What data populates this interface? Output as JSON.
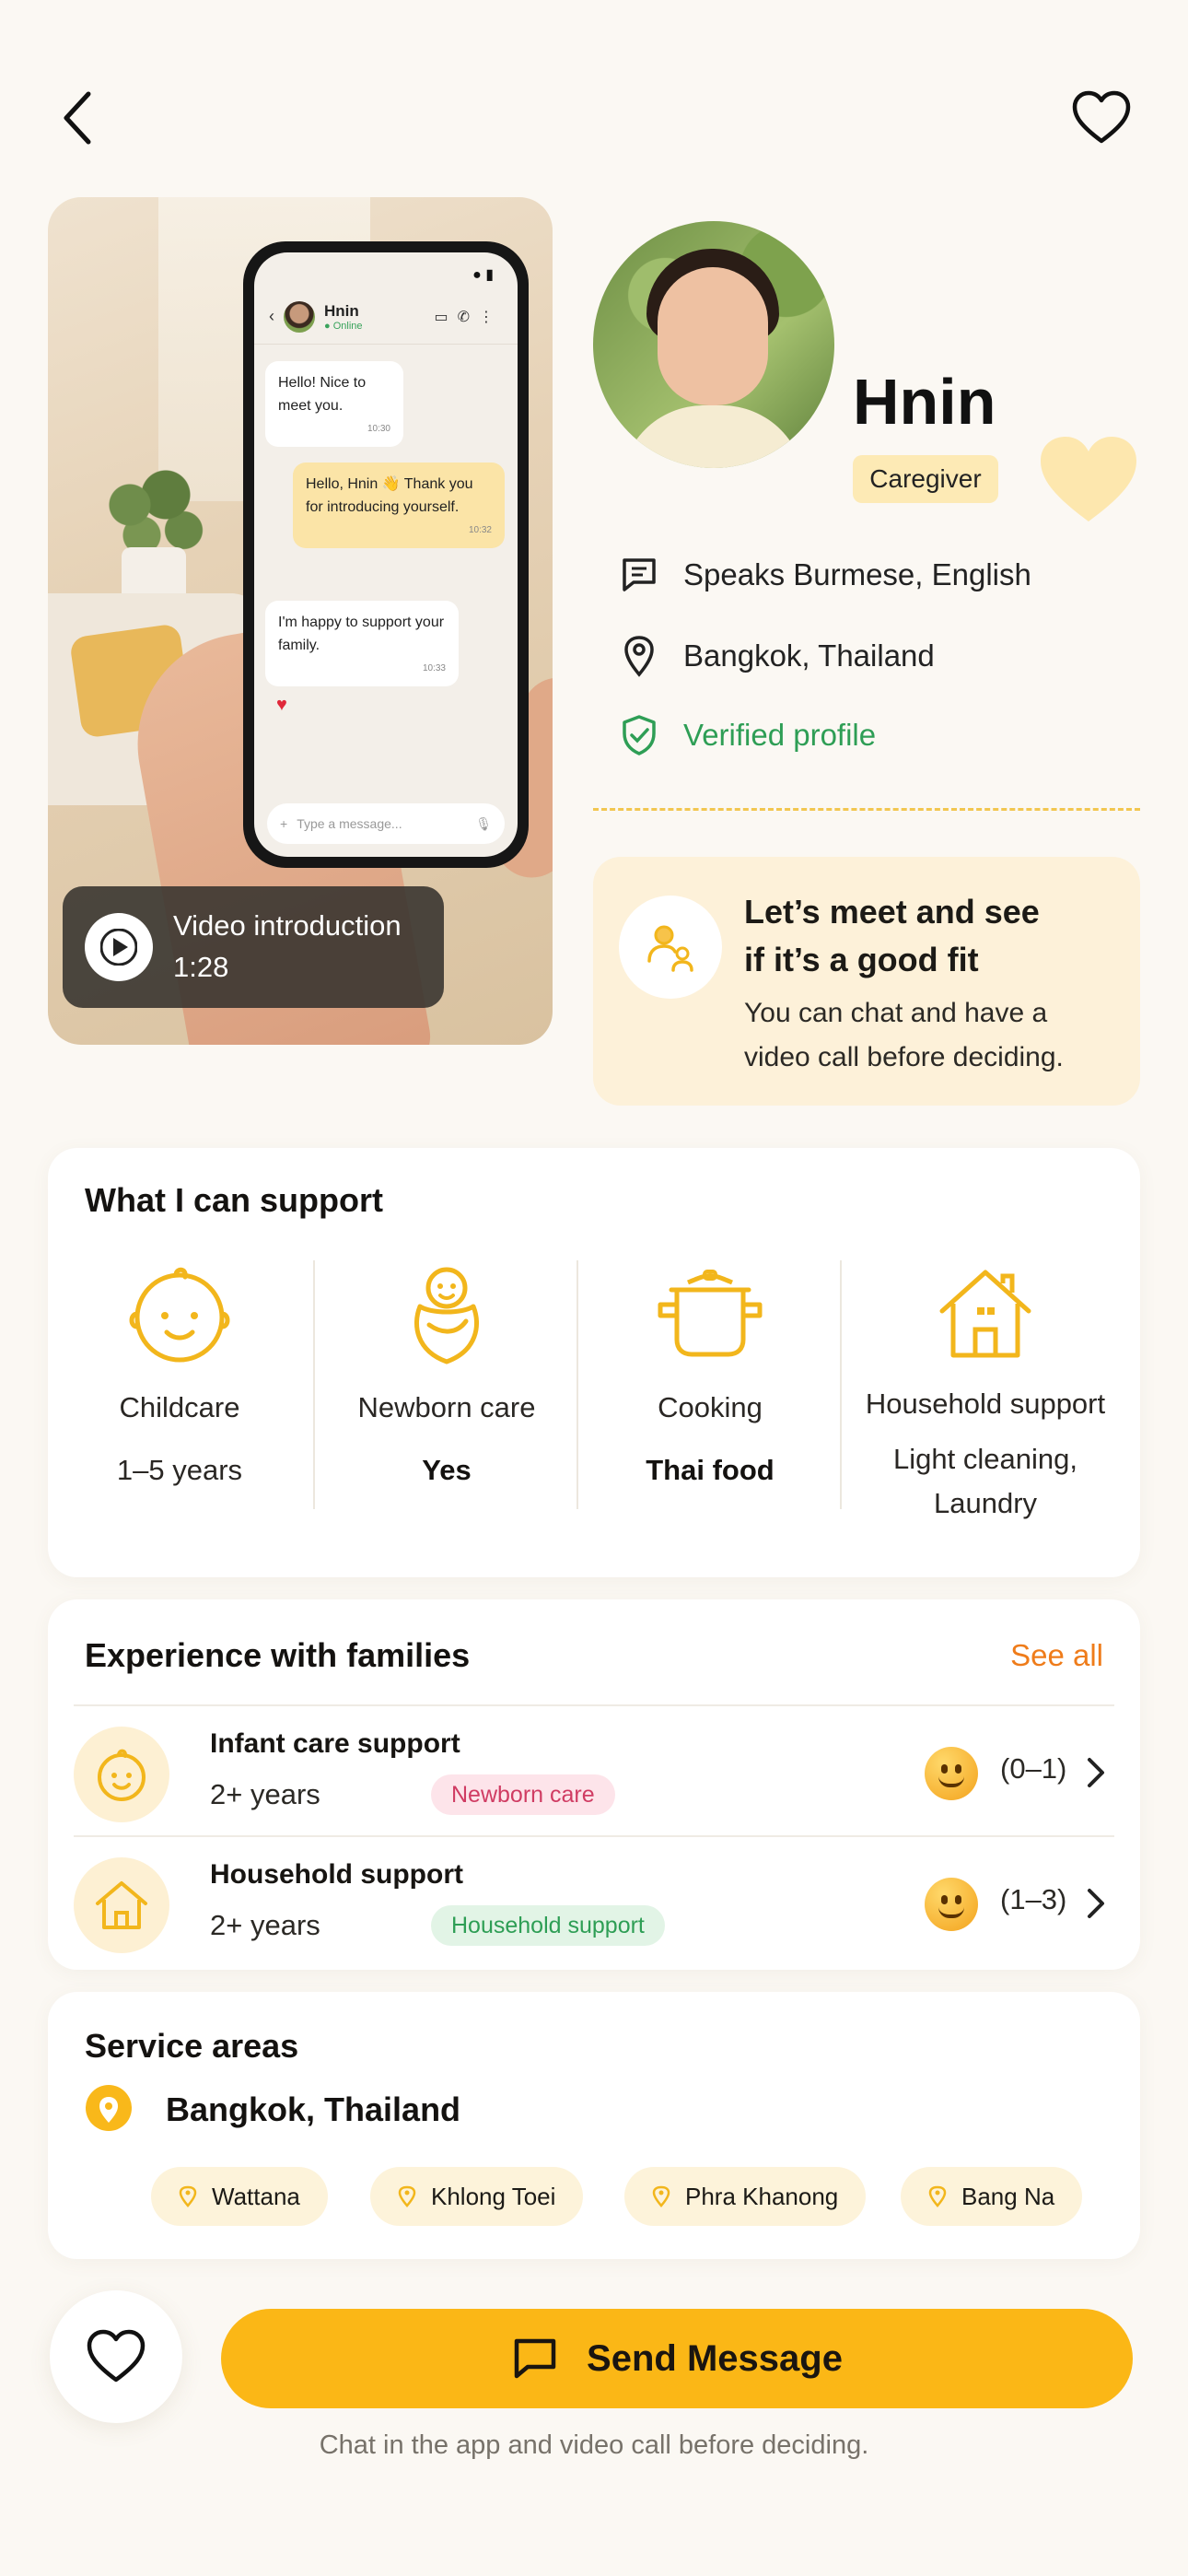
{
  "header": {
    "back_icon": "chevron-left-icon",
    "favorite_icon": "heart-outline-icon"
  },
  "video": {
    "phone_chat": {
      "contact_name": "Hnin",
      "contact_status": "Online",
      "messages": [
        {
          "text": "Hello! Nice to meet you.",
          "time": "10:30",
          "direction": "in"
        },
        {
          "text": "Hello, Hnin 👋 Thank you for introducing yourself.",
          "time": "10:32",
          "direction": "out"
        },
        {
          "text": "I'm happy to support your family.",
          "time": "10:33",
          "direction": "in"
        }
      ],
      "input_placeholder": "Type a message..."
    },
    "label": "Video introduction",
    "duration": "1:28"
  },
  "profile": {
    "name": "Hnin",
    "role": "Caregiver",
    "languages": "Speaks Burmese, English",
    "location": "Bangkok, Thailand",
    "verified": "Verified profile"
  },
  "meet": {
    "title_line1": "Let’s meet and see",
    "title_line2": "if it’s a good fit",
    "sub_line1": "You can chat and have a",
    "sub_line2": "video call before deciding."
  },
  "support": {
    "title": "What I can support",
    "items": [
      {
        "label": "Childcare",
        "value": "1–5 years",
        "icon": "child-face-icon"
      },
      {
        "label": "Newborn care",
        "value": "Yes",
        "icon": "baby-icon"
      },
      {
        "label": "Cooking",
        "value": "Thai food",
        "icon": "cooking-pot-icon"
      },
      {
        "label": "Household support",
        "value_line1": "Light cleaning,",
        "value_line2": "Laundry",
        "icon": "house-icon"
      }
    ]
  },
  "experience": {
    "title": "Experience with families",
    "see_all": "See all",
    "items": [
      {
        "title": "Infant care support",
        "years": "2+ years",
        "tag": "Newborn care",
        "range": "(0–1)"
      },
      {
        "title": "Household support",
        "years": "2+ years",
        "tag": "Household support",
        "range": "(1–3)"
      }
    ]
  },
  "service_areas": {
    "title": "Service areas",
    "main": "Bangkok, Thailand",
    "chips": [
      "Wattana",
      "Khlong Toei",
      "Phra Khanong",
      "Bang Na"
    ]
  },
  "footer": {
    "send_label": "Send Message",
    "note": "Chat in the app and video call before deciding."
  },
  "colors": {
    "accent": "#fbb716",
    "see_all": "#ef7c1a",
    "verified": "#2e9e55",
    "icon_yellow": "#f2b61c"
  }
}
